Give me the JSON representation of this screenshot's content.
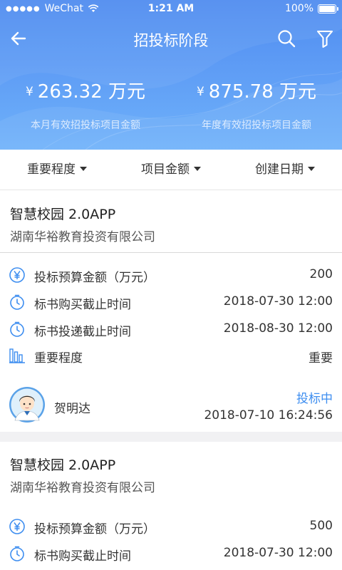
{
  "status_bar": {
    "dots": "●●●●●",
    "carrier": "WeChat",
    "time": "1:21 AM",
    "battery": "100%"
  },
  "nav": {
    "title": "招投标阶段",
    "icons": [
      "back-arrow-icon",
      "search-icon",
      "filter-icon"
    ]
  },
  "summary": {
    "currency_symbol": "¥",
    "monthly": {
      "amount": "263.32 万元",
      "label": "本月有效招投标项目金额"
    },
    "yearly": {
      "amount": "875.78 万元",
      "label": "年度有效招投标项目金额"
    }
  },
  "filters": [
    {
      "label": "重要程度"
    },
    {
      "label": "项目金额"
    },
    {
      "label": "创建日期"
    }
  ],
  "projects": [
    {
      "title": "智慧校园 2.0APP",
      "company": "湖南华裕教育投资有限公司",
      "rows": [
        {
          "icon": "yen-icon",
          "label": "投标预算金额（万元）",
          "value": "200"
        },
        {
          "icon": "timer-icon",
          "label": "标书购买截止时间",
          "value": "2018-07-30 12:00"
        },
        {
          "icon": "timer-icon",
          "label": "标书投递截止时间",
          "value": "2018-08-30 12:00"
        },
        {
          "icon": "bar-chart-icon",
          "label": "重要程度",
          "value": "重要"
        }
      ],
      "owner": "贺明达",
      "status": "投标中",
      "timestamp": "2018-07-10 16:24:56"
    },
    {
      "title": "智慧校园 2.0APP",
      "company": "湖南华裕教育投资有限公司",
      "rows": [
        {
          "icon": "yen-icon",
          "label": "投标预算金额（万元）",
          "value": "500"
        },
        {
          "icon": "timer-icon",
          "label": "标书购买截止时间",
          "value": "2018-07-30 12:00"
        }
      ]
    }
  ],
  "colors": {
    "header_gradient_top": "#4f8cf0",
    "header_gradient_bottom": "#6fb2fa",
    "accent_blue": "#3e8ef0",
    "status_color": "#3e8ef0"
  }
}
